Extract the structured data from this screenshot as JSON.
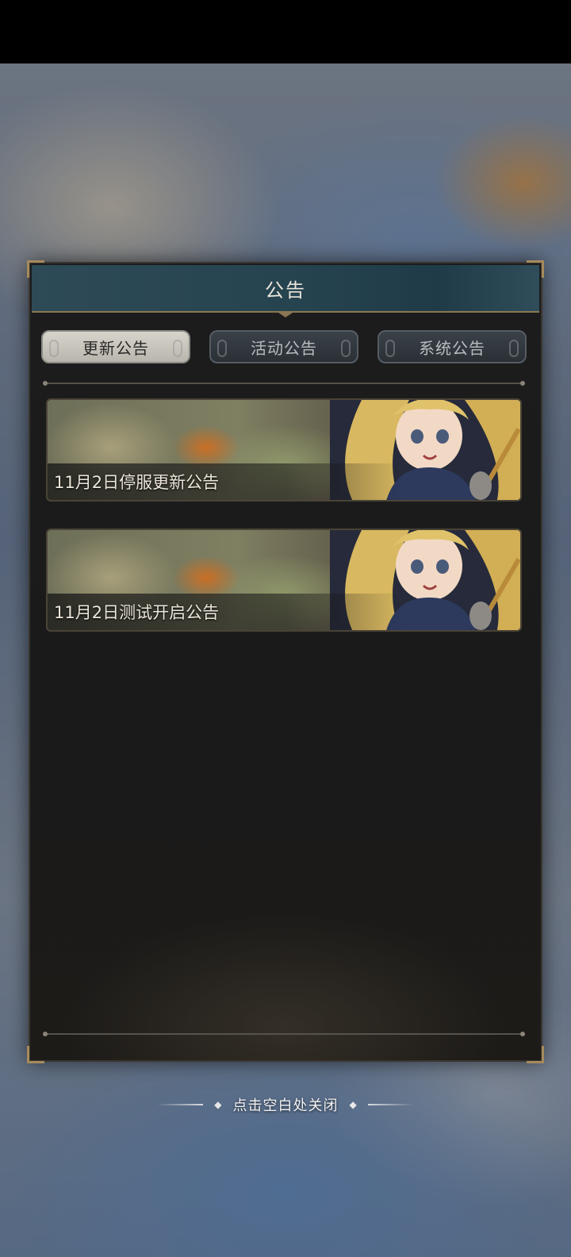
{
  "dialog": {
    "title": "公告",
    "tabs": [
      {
        "label": "更新公告",
        "active": true
      },
      {
        "label": "活动公告",
        "active": false
      },
      {
        "label": "系统公告",
        "active": false
      }
    ],
    "announcements": [
      {
        "title": "11月2日停服更新公告"
      },
      {
        "title": "11月2日测试开启公告"
      }
    ]
  },
  "hint": {
    "text": "点击空白处关闭"
  },
  "colors": {
    "title_bar": "#264450",
    "accent_gold": "#a58a5c",
    "panel_bg": "#1c1c1d"
  }
}
